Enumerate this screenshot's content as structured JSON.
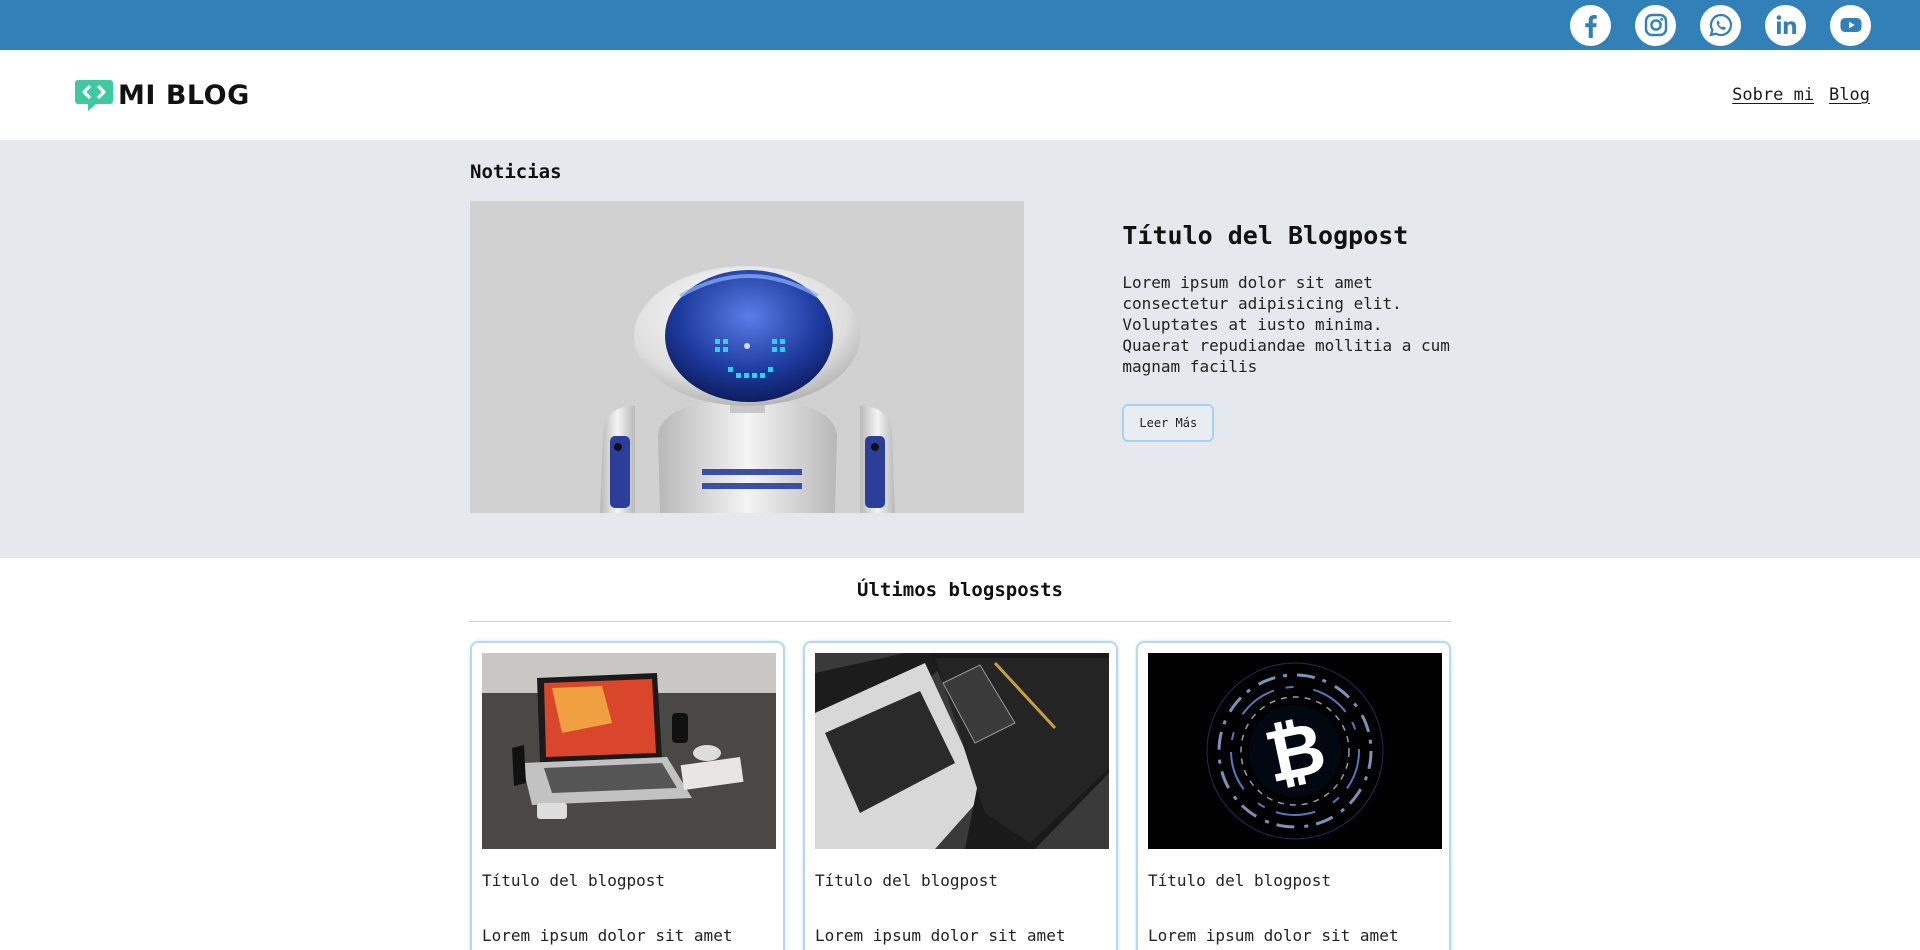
{
  "social": [
    {
      "name": "facebook"
    },
    {
      "name": "instagram"
    },
    {
      "name": "whatsapp"
    },
    {
      "name": "linkedin"
    },
    {
      "name": "youtube"
    }
  ],
  "header": {
    "logo_text": "MI BLOG",
    "nav": [
      "Sobre mi",
      "Blog"
    ]
  },
  "hero": {
    "heading": "Noticias",
    "post_title": "Título del Blogpost",
    "post_body": "Lorem ipsum dolor sit amet consectetur adipisicing elit. Voluptates at iusto minima. Quaerat repudiandae mollitia a cum magnam facilis",
    "button_label": "Leer Más"
  },
  "latest": {
    "title": "Últimos blogsposts",
    "cards": [
      {
        "title": "Título del blogpost",
        "body": "Lorem ipsum dolor sit amet"
      },
      {
        "title": "Título del blogpost",
        "body": "Lorem ipsum dolor sit amet"
      },
      {
        "title": "Título del blogpost",
        "body": "Lorem ipsum dolor sit amet"
      }
    ]
  },
  "colors": {
    "topbar": "#3181b8",
    "logo_accent": "#3ec9a3",
    "hero_bg": "#e5e8ec",
    "card_border": "#b7d9ef"
  }
}
